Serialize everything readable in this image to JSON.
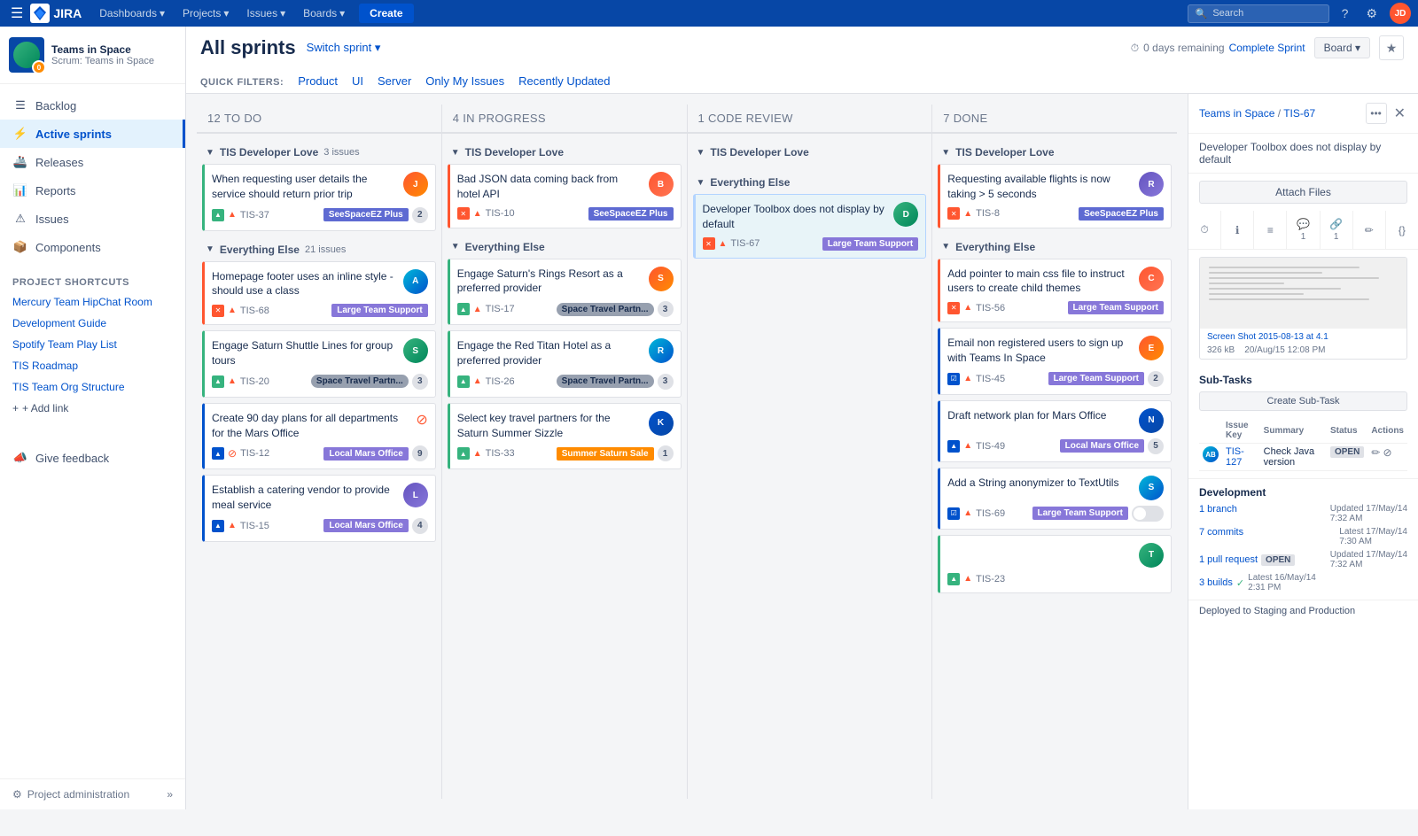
{
  "topNav": {
    "logoText": "JIRA",
    "dashboards": "Dashboards",
    "projects": "Projects",
    "issues": "Issues",
    "boards": "Boards",
    "createBtn": "Create",
    "searchPlaceholder": "Search",
    "helpLabel": "Help",
    "settingsLabel": "Settings",
    "avatarInitials": "JD"
  },
  "sidebar": {
    "projectName": "Teams in Space",
    "projectType": "Scrum: Teams in Space",
    "avatarBadge": "0",
    "nav": [
      {
        "id": "backlog",
        "label": "Backlog",
        "icon": "list"
      },
      {
        "id": "active-sprints",
        "label": "Active sprints",
        "icon": "bolt",
        "active": true
      },
      {
        "id": "releases",
        "label": "Releases",
        "icon": "ship"
      },
      {
        "id": "reports",
        "label": "Reports",
        "icon": "chart"
      },
      {
        "id": "issues",
        "label": "Issues",
        "icon": "issue"
      },
      {
        "id": "components",
        "label": "Components",
        "icon": "box"
      }
    ],
    "shortcuts": {
      "label": "Project Shortcuts",
      "items": [
        "Mercury Team HipChat Room",
        "Development Guide",
        "Spotify Team Play List",
        "TIS Roadmap",
        "TIS Team Org Structure"
      ]
    },
    "addLinkLabel": "+ Add link",
    "feedbackLabel": "Give feedback",
    "adminLabel": "Project administration"
  },
  "board": {
    "title": "All sprints",
    "switchSprintLabel": "Switch sprint ▾",
    "daysRemaining": "0 days remaining",
    "completeSprintBtn": "Complete Sprint",
    "boardViewBtn": "Board ▾",
    "quickFiltersLabel": "QUICK FILTERS:",
    "filters": [
      "Product",
      "UI",
      "Server",
      "Only My Issues",
      "Recently Updated"
    ],
    "columns": [
      {
        "id": "todo",
        "title": "To Do",
        "count": 12,
        "groups": [
          {
            "name": "TIS Developer Love",
            "issueCount": 3,
            "cards": [
              {
                "key": "TIS-37",
                "type": "story",
                "priority": "high",
                "summary": "When requesting user details the service should return prior trip",
                "label": "SeeSpaceEZ Plus",
                "labelClass": "label-seespace",
                "count": 2,
                "avatarClass": "av1",
                "avatarInitials": "JD",
                "borderClass": "col-left-border-green"
              }
            ]
          },
          {
            "name": "Everything Else",
            "issueCount": 21,
            "cards": [
              {
                "key": "TIS-68",
                "type": "bug",
                "priority": "high",
                "summary": "Homepage footer uses an inline style - should use a class",
                "label": "Large Team Support",
                "labelClass": "label-largeTeam",
                "count": null,
                "avatarClass": "av2",
                "avatarInitials": "AB",
                "borderClass": "col-left-border-red"
              },
              {
                "key": "TIS-20",
                "type": "story",
                "priority": "high",
                "summary": "Engage Saturn Shuttle Lines for group tours",
                "label": "Space Travel Partn...",
                "labelClass": "label-spaceTravel",
                "count": 3,
                "avatarClass": "av3",
                "avatarInitials": "ST",
                "borderClass": "col-left-border-green"
              },
              {
                "key": "TIS-12",
                "type": "improvement",
                "priority": "blocked",
                "summary": "Create 90 day plans for all departments for the Mars Office",
                "label": "Local Mars Office",
                "labelClass": "label-localMars",
                "count": 9,
                "avatarClass": null,
                "avatarInitials": null,
                "borderClass": "col-left-border-blue"
              },
              {
                "key": "TIS-15",
                "type": "improvement",
                "priority": "high",
                "summary": "Establish a catering vendor to provide meal service",
                "label": "Local Mars Office",
                "labelClass": "label-localMars",
                "count": 4,
                "avatarClass": "av4",
                "avatarInitials": "LM",
                "borderClass": "col-left-border-blue"
              }
            ]
          }
        ]
      },
      {
        "id": "inprogress",
        "title": "In Progress",
        "count": 4,
        "groups": [
          {
            "name": "TIS Developer Love",
            "issueCount": null,
            "cards": [
              {
                "key": "TIS-10",
                "type": "bug",
                "priority": "high",
                "summary": "Bad JSON data coming back from hotel API",
                "label": "SeeSpaceEZ Plus",
                "labelClass": "label-seespace",
                "count": null,
                "avatarClass": "av5",
                "avatarInitials": "BD",
                "borderClass": "col-left-border-red"
              }
            ]
          },
          {
            "name": "Everything Else",
            "issueCount": null,
            "cards": [
              {
                "key": "TIS-17",
                "type": "story",
                "priority": "high",
                "summary": "Engage Saturn's Rings Resort as a preferred provider",
                "label": "Space Travel Partn...",
                "labelClass": "label-spaceTravel",
                "count": 3,
                "avatarClass": "av1",
                "avatarInitials": "SR",
                "borderClass": "col-left-border-green"
              },
              {
                "key": "TIS-26",
                "type": "story",
                "priority": "high",
                "summary": "Engage the Red Titan Hotel as a preferred provider",
                "label": "Space Travel Partn...",
                "labelClass": "label-spaceTravel",
                "count": 3,
                "avatarClass": "av2",
                "avatarInitials": "RT",
                "borderClass": "col-left-border-green"
              },
              {
                "key": "TIS-33",
                "type": "story",
                "priority": "high",
                "summary": "Select key travel partners for the Saturn Summer Sizzle",
                "label": "Summer Saturn Sale",
                "labelClass": "label-summerSaturn",
                "count": 1,
                "avatarClass": "av6",
                "avatarInitials": "KT",
                "borderClass": "col-left-border-green"
              }
            ]
          }
        ]
      },
      {
        "id": "codereview",
        "title": "Code Review",
        "count": 1,
        "groups": [
          {
            "name": "TIS Developer Love",
            "issueCount": null,
            "cards": []
          },
          {
            "name": "Everything Else",
            "issueCount": null,
            "cards": [
              {
                "key": "TIS-67",
                "type": "bug",
                "priority": "high",
                "summary": "Developer Toolbox does not display by default",
                "label": "Large Team Support",
                "labelClass": "label-largeTeam",
                "count": null,
                "avatarClass": "av3",
                "avatarInitials": "DT",
                "borderClass": "col-left-border-red",
                "highlighted": true
              }
            ]
          }
        ]
      },
      {
        "id": "done",
        "title": "Done",
        "count": 7,
        "groups": [
          {
            "name": "TIS Developer Love",
            "issueCount": null,
            "cards": [
              {
                "key": "TIS-8",
                "type": "bug",
                "priority": "high",
                "summary": "Requesting available flights is now taking > 5 seconds",
                "label": "SeeSpaceEZ Plus",
                "labelClass": "label-seespace",
                "count": null,
                "avatarClass": "av4",
                "avatarInitials": "RF",
                "borderClass": "col-left-border-red"
              }
            ]
          },
          {
            "name": "Everything Else",
            "issueCount": null,
            "cards": [
              {
                "key": "TIS-56",
                "type": "bug",
                "priority": "high",
                "summary": "Add pointer to main css file to instruct users to create child themes",
                "label": "Large Team Support",
                "labelClass": "label-largeTeam",
                "count": null,
                "avatarClass": "av5",
                "avatarInitials": "CS",
                "borderClass": "col-left-border-red"
              },
              {
                "key": "TIS-45",
                "type": "task",
                "priority": "high",
                "summary": "Email non registered users to sign up with Teams In Space",
                "label": "Large Team Support",
                "labelClass": "label-largeTeam",
                "count": 2,
                "avatarClass": "av1",
                "avatarInitials": "EU",
                "borderClass": "col-left-border-blue"
              },
              {
                "key": "TIS-49",
                "type": "improvement",
                "priority": "high",
                "summary": "Draft network plan for Mars Office",
                "label": "Local Mars Office",
                "labelClass": "label-localMars",
                "count": 5,
                "avatarClass": "av6",
                "avatarInitials": "NP",
                "borderClass": "col-left-border-blue"
              },
              {
                "key": "TIS-69",
                "type": "task",
                "priority": "high",
                "summary": "Add a String anonymizer to TextUtils",
                "label": "Large Team Support",
                "labelClass": "label-largeTeam",
                "count": null,
                "avatarClass": "av2",
                "avatarInitials": "SA",
                "borderClass": "col-left-border-blue",
                "hasToggle": true
              },
              {
                "key": "TIS-23",
                "type": "story",
                "priority": "high",
                "summary": "",
                "label": "",
                "labelClass": "",
                "count": null,
                "avatarClass": "av3",
                "avatarInitials": "TI",
                "borderClass": "col-left-border-green"
              }
            ]
          }
        ]
      }
    ]
  },
  "detailPanel": {
    "breadcrumbProject": "Teams in Space",
    "breadcrumbIssue": "TIS-67",
    "subtitle": "Developer Toolbox does not display by default",
    "attachFilesBtn": "Attach Files",
    "icons": [
      {
        "name": "clock",
        "symbol": "⏱",
        "count": ""
      },
      {
        "name": "info",
        "symbol": "ℹ",
        "count": ""
      },
      {
        "name": "list",
        "symbol": "≡",
        "count": ""
      },
      {
        "name": "comment",
        "symbol": "💬",
        "count": "1"
      },
      {
        "name": "link",
        "symbol": "🔗",
        "count": "1"
      },
      {
        "name": "pencil",
        "symbol": "✏",
        "count": ""
      },
      {
        "name": "code",
        "symbol": "{}",
        "count": ""
      }
    ],
    "screenshotName": "Screen Shot 2015-08-13 at 4.1",
    "screenshotSize": "326 kB",
    "screenshotDate": "20/Aug/15 12:08 PM",
    "subTasksTitle": "Sub-Tasks",
    "createSubTaskBtn": "Create Sub-Task",
    "subTasksColumns": [
      "Issue Key",
      "Summary",
      "Status",
      "Actions"
    ],
    "subTasks": [
      {
        "avatar": "av2",
        "avatarInitials": "AB",
        "key": "TIS-127",
        "summary": "Check Java version",
        "status": "OPEN",
        "actions": [
          "✏",
          "⊘"
        ]
      }
    ],
    "devTitle": "Development",
    "devItems": [
      {
        "label": "1 branch",
        "metaLine1": "Updated 17/May/14",
        "metaLine2": "7:32 AM"
      },
      {
        "label": "7 commits",
        "metaLine1": "Latest 17/May/14",
        "metaLine2": "7:30 AM"
      },
      {
        "label": "1 pull request",
        "badge": "OPEN",
        "metaLine1": "Updated 17/May/14",
        "metaLine2": "7:32 AM"
      },
      {
        "label": "3 builds",
        "check": true,
        "metaLine1": "Latest 16/May/14",
        "metaLine2": "2:31 PM"
      }
    ],
    "deployedText": "Deployed to Staging and Production"
  }
}
